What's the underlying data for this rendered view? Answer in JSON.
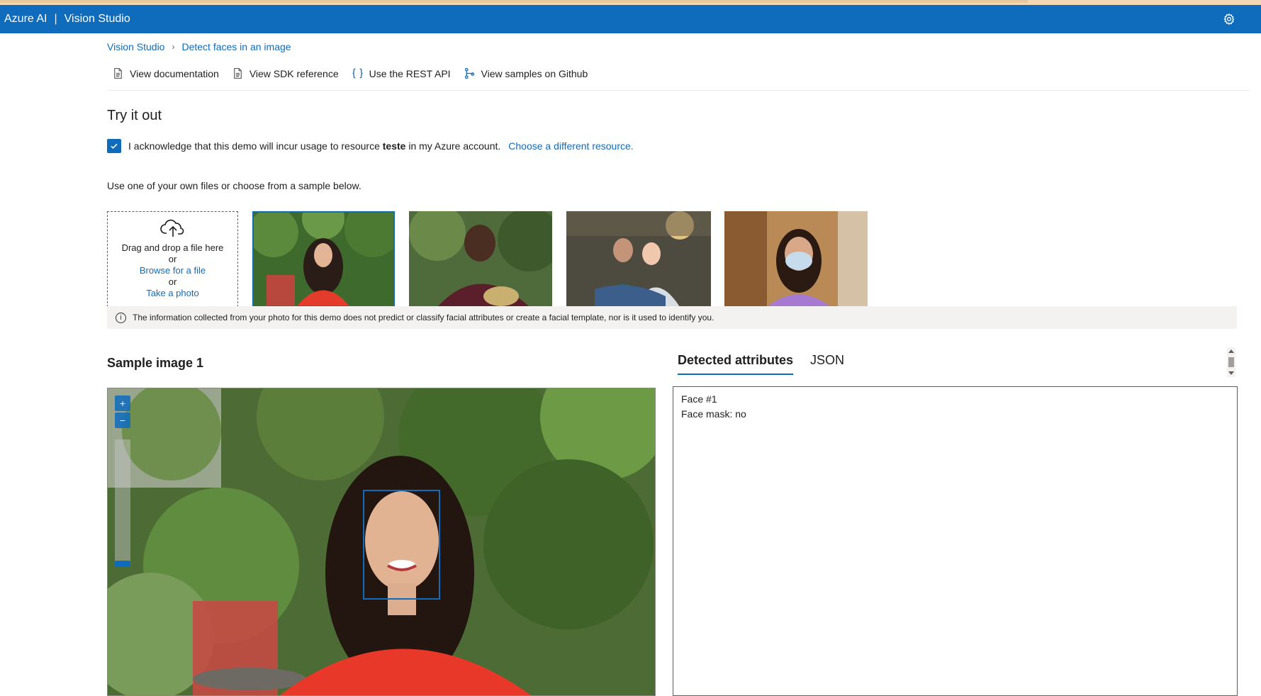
{
  "header": {
    "brand": "Azure AI",
    "separator": "|",
    "product": "Vision Studio"
  },
  "breadcrumb": {
    "root": "Vision Studio",
    "current": "Detect faces in an image"
  },
  "links": [
    {
      "label": "View documentation",
      "icon": "document-icon"
    },
    {
      "label": "View SDK reference",
      "icon": "document-icon"
    },
    {
      "label": "Use the REST API",
      "icon": "braces-icon"
    },
    {
      "label": "View samples on Github",
      "icon": "branch-icon"
    }
  ],
  "page": {
    "title": "Try it out"
  },
  "acknowledge": {
    "prefix": "I acknowledge that this demo will incur usage to resource",
    "resource": "teste",
    "suffix": "in my Azure account.",
    "link": "Choose a different resource.",
    "checked": true
  },
  "hint": "Use one of your own files or choose from a sample below.",
  "dropzone": {
    "line1": "Drag and drop a file here",
    "or1": "or",
    "browse": "Browse for a file",
    "or2": "or",
    "photo": "Take a photo"
  },
  "info_text": "The information collected from your photo for this demo does not predict or classify facial attributes or create a facial template, nor is it used to identify you.",
  "sample": {
    "title": "Sample image 1"
  },
  "tabs": {
    "attributes": "Detected attributes",
    "json": "JSON",
    "active": "attributes"
  },
  "results": {
    "face": "Face #1",
    "mask": "Face mask: no"
  },
  "colors": {
    "accent": "#0f6cbd",
    "header": "#0f6cbd"
  }
}
